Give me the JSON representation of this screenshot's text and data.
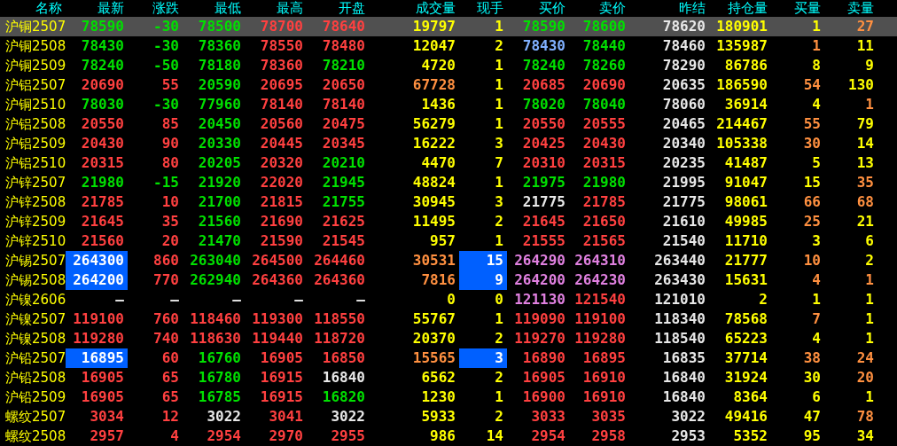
{
  "table": {
    "columns": [
      "名称",
      "最新",
      "涨跌",
      "最低",
      "最高",
      "开盘",
      "成交量",
      "现手",
      "买价",
      "卖价",
      "昨结",
      "持仓量",
      "买量",
      "卖量"
    ],
    "rows": [
      {
        "selected": true,
        "cells": [
          {
            "text": "沪铜2507",
            "color": "#ffff00",
            "flash": false
          },
          {
            "text": "78590",
            "color": "#00e000",
            "flash": false
          },
          {
            "text": "-30",
            "color": "#00e000",
            "flash": false
          },
          {
            "text": "78500",
            "color": "#00e000",
            "flash": false
          },
          {
            "text": "78700",
            "color": "#ff4040",
            "flash": false
          },
          {
            "text": "78640",
            "color": "#ff4040",
            "flash": false
          },
          {
            "text": "19797",
            "color": "#ffff00",
            "flash": false
          },
          {
            "text": "1",
            "color": "#ffff00",
            "flash": false
          },
          {
            "text": "78590",
            "color": "#00e000",
            "flash": false
          },
          {
            "text": "78600",
            "color": "#00e000",
            "flash": false
          },
          {
            "text": "78620",
            "color": "#e8e8e8",
            "flash": false
          },
          {
            "text": "180901",
            "color": "#ffff00",
            "flash": false
          },
          {
            "text": "1",
            "color": "#ffff00",
            "flash": false
          },
          {
            "text": "27",
            "color": "#ff9040",
            "flash": false
          }
        ]
      },
      {
        "selected": false,
        "cells": [
          {
            "text": "沪铜2508",
            "color": "#ffff00",
            "flash": false
          },
          {
            "text": "78430",
            "color": "#00e000",
            "flash": false
          },
          {
            "text": "-30",
            "color": "#00e000",
            "flash": false
          },
          {
            "text": "78360",
            "color": "#00e000",
            "flash": false
          },
          {
            "text": "78550",
            "color": "#ff4040",
            "flash": false
          },
          {
            "text": "78480",
            "color": "#ff4040",
            "flash": false
          },
          {
            "text": "12047",
            "color": "#ffff00",
            "flash": false
          },
          {
            "text": "2",
            "color": "#ffff00",
            "flash": false
          },
          {
            "text": "78430",
            "color": "#80b0ff",
            "flash": false
          },
          {
            "text": "78440",
            "color": "#00e000",
            "flash": false
          },
          {
            "text": "78460",
            "color": "#e8e8e8",
            "flash": false
          },
          {
            "text": "135987",
            "color": "#ffff00",
            "flash": false
          },
          {
            "text": "1",
            "color": "#ff9040",
            "flash": false
          },
          {
            "text": "11",
            "color": "#ffff00",
            "flash": false
          }
        ]
      },
      {
        "selected": false,
        "cells": [
          {
            "text": "沪铜2509",
            "color": "#ffff00",
            "flash": false
          },
          {
            "text": "78240",
            "color": "#00e000",
            "flash": false
          },
          {
            "text": "-50",
            "color": "#00e000",
            "flash": false
          },
          {
            "text": "78180",
            "color": "#00e000",
            "flash": false
          },
          {
            "text": "78360",
            "color": "#ff4040",
            "flash": false
          },
          {
            "text": "78210",
            "color": "#00e000",
            "flash": false
          },
          {
            "text": "4720",
            "color": "#ffff00",
            "flash": false
          },
          {
            "text": "1",
            "color": "#ffff00",
            "flash": false
          },
          {
            "text": "78240",
            "color": "#00e000",
            "flash": false
          },
          {
            "text": "78260",
            "color": "#00e000",
            "flash": false
          },
          {
            "text": "78290",
            "color": "#e8e8e8",
            "flash": false
          },
          {
            "text": "86786",
            "color": "#ffff00",
            "flash": false
          },
          {
            "text": "8",
            "color": "#ffff00",
            "flash": false
          },
          {
            "text": "9",
            "color": "#ffff00",
            "flash": false
          }
        ]
      },
      {
        "selected": false,
        "cells": [
          {
            "text": "沪铝2507",
            "color": "#ffff00",
            "flash": false
          },
          {
            "text": "20690",
            "color": "#ff4040",
            "flash": false
          },
          {
            "text": "55",
            "color": "#ff4040",
            "flash": false
          },
          {
            "text": "20590",
            "color": "#00e000",
            "flash": false
          },
          {
            "text": "20695",
            "color": "#ff4040",
            "flash": false
          },
          {
            "text": "20650",
            "color": "#ff4040",
            "flash": false
          },
          {
            "text": "67728",
            "color": "#ff9040",
            "flash": false
          },
          {
            "text": "1",
            "color": "#ffff00",
            "flash": false
          },
          {
            "text": "20685",
            "color": "#ff4040",
            "flash": false
          },
          {
            "text": "20690",
            "color": "#ff4040",
            "flash": false
          },
          {
            "text": "20635",
            "color": "#e8e8e8",
            "flash": false
          },
          {
            "text": "186590",
            "color": "#ffff00",
            "flash": false
          },
          {
            "text": "54",
            "color": "#ff9040",
            "flash": false
          },
          {
            "text": "130",
            "color": "#ffff00",
            "flash": false
          }
        ]
      },
      {
        "selected": false,
        "cells": [
          {
            "text": "沪铜2510",
            "color": "#ffff00",
            "flash": false
          },
          {
            "text": "78030",
            "color": "#00e000",
            "flash": false
          },
          {
            "text": "-30",
            "color": "#00e000",
            "flash": false
          },
          {
            "text": "77960",
            "color": "#00e000",
            "flash": false
          },
          {
            "text": "78140",
            "color": "#ff4040",
            "flash": false
          },
          {
            "text": "78140",
            "color": "#ff4040",
            "flash": false
          },
          {
            "text": "1436",
            "color": "#ffff00",
            "flash": false
          },
          {
            "text": "1",
            "color": "#ffff00",
            "flash": false
          },
          {
            "text": "78020",
            "color": "#00e000",
            "flash": false
          },
          {
            "text": "78040",
            "color": "#00e000",
            "flash": false
          },
          {
            "text": "78060",
            "color": "#e8e8e8",
            "flash": false
          },
          {
            "text": "36914",
            "color": "#ffff00",
            "flash": false
          },
          {
            "text": "4",
            "color": "#ffff00",
            "flash": false
          },
          {
            "text": "1",
            "color": "#ff9040",
            "flash": false
          }
        ]
      },
      {
        "selected": false,
        "cells": [
          {
            "text": "沪铝2508",
            "color": "#ffff00",
            "flash": false
          },
          {
            "text": "20550",
            "color": "#ff4040",
            "flash": false
          },
          {
            "text": "85",
            "color": "#ff4040",
            "flash": false
          },
          {
            "text": "20450",
            "color": "#00e000",
            "flash": false
          },
          {
            "text": "20560",
            "color": "#ff4040",
            "flash": false
          },
          {
            "text": "20475",
            "color": "#ff4040",
            "flash": false
          },
          {
            "text": "56279",
            "color": "#ffff00",
            "flash": false
          },
          {
            "text": "1",
            "color": "#ffff00",
            "flash": false
          },
          {
            "text": "20550",
            "color": "#ff4040",
            "flash": false
          },
          {
            "text": "20555",
            "color": "#ff4040",
            "flash": false
          },
          {
            "text": "20465",
            "color": "#e8e8e8",
            "flash": false
          },
          {
            "text": "214467",
            "color": "#ffff00",
            "flash": false
          },
          {
            "text": "55",
            "color": "#ff9040",
            "flash": false
          },
          {
            "text": "79",
            "color": "#ffff00",
            "flash": false
          }
        ]
      },
      {
        "selected": false,
        "cells": [
          {
            "text": "沪铝2509",
            "color": "#ffff00",
            "flash": false
          },
          {
            "text": "20430",
            "color": "#ff4040",
            "flash": false
          },
          {
            "text": "90",
            "color": "#ff4040",
            "flash": false
          },
          {
            "text": "20330",
            "color": "#00e000",
            "flash": false
          },
          {
            "text": "20445",
            "color": "#ff4040",
            "flash": false
          },
          {
            "text": "20345",
            "color": "#ff4040",
            "flash": false
          },
          {
            "text": "16222",
            "color": "#ffff00",
            "flash": false
          },
          {
            "text": "3",
            "color": "#ffff00",
            "flash": false
          },
          {
            "text": "20425",
            "color": "#ff4040",
            "flash": false
          },
          {
            "text": "20430",
            "color": "#ff4040",
            "flash": false
          },
          {
            "text": "20340",
            "color": "#e8e8e8",
            "flash": false
          },
          {
            "text": "105338",
            "color": "#ffff00",
            "flash": false
          },
          {
            "text": "30",
            "color": "#ff9040",
            "flash": false
          },
          {
            "text": "14",
            "color": "#ffff00",
            "flash": false
          }
        ]
      },
      {
        "selected": false,
        "cells": [
          {
            "text": "沪铝2510",
            "color": "#ffff00",
            "flash": false
          },
          {
            "text": "20315",
            "color": "#ff4040",
            "flash": false
          },
          {
            "text": "80",
            "color": "#ff4040",
            "flash": false
          },
          {
            "text": "20205",
            "color": "#00e000",
            "flash": false
          },
          {
            "text": "20320",
            "color": "#ff4040",
            "flash": false
          },
          {
            "text": "20210",
            "color": "#00e000",
            "flash": false
          },
          {
            "text": "4470",
            "color": "#ffff00",
            "flash": false
          },
          {
            "text": "7",
            "color": "#ffff00",
            "flash": false
          },
          {
            "text": "20310",
            "color": "#ff4040",
            "flash": false
          },
          {
            "text": "20315",
            "color": "#ff4040",
            "flash": false
          },
          {
            "text": "20235",
            "color": "#e8e8e8",
            "flash": false
          },
          {
            "text": "41487",
            "color": "#ffff00",
            "flash": false
          },
          {
            "text": "5",
            "color": "#ffff00",
            "flash": false
          },
          {
            "text": "13",
            "color": "#ffff00",
            "flash": false
          }
        ]
      },
      {
        "selected": false,
        "cells": [
          {
            "text": "沪锌2507",
            "color": "#ffff00",
            "flash": false
          },
          {
            "text": "21980",
            "color": "#00e000",
            "flash": false
          },
          {
            "text": "-15",
            "color": "#00e000",
            "flash": false
          },
          {
            "text": "21920",
            "color": "#00e000",
            "flash": false
          },
          {
            "text": "22020",
            "color": "#ff4040",
            "flash": false
          },
          {
            "text": "21945",
            "color": "#00e000",
            "flash": false
          },
          {
            "text": "48824",
            "color": "#ffff00",
            "flash": false
          },
          {
            "text": "1",
            "color": "#ffff00",
            "flash": false
          },
          {
            "text": "21975",
            "color": "#00e000",
            "flash": false
          },
          {
            "text": "21980",
            "color": "#00e000",
            "flash": false
          },
          {
            "text": "21995",
            "color": "#e8e8e8",
            "flash": false
          },
          {
            "text": "91047",
            "color": "#ffff00",
            "flash": false
          },
          {
            "text": "15",
            "color": "#ffff00",
            "flash": false
          },
          {
            "text": "35",
            "color": "#ff9040",
            "flash": false
          }
        ]
      },
      {
        "selected": false,
        "cells": [
          {
            "text": "沪锌2508",
            "color": "#ffff00",
            "flash": false
          },
          {
            "text": "21785",
            "color": "#ff4040",
            "flash": false
          },
          {
            "text": "10",
            "color": "#ff4040",
            "flash": false
          },
          {
            "text": "21700",
            "color": "#00e000",
            "flash": false
          },
          {
            "text": "21815",
            "color": "#ff4040",
            "flash": false
          },
          {
            "text": "21755",
            "color": "#00e000",
            "flash": false
          },
          {
            "text": "30945",
            "color": "#ffff00",
            "flash": false
          },
          {
            "text": "3",
            "color": "#ffff00",
            "flash": false
          },
          {
            "text": "21775",
            "color": "#e8e8e8",
            "flash": false
          },
          {
            "text": "21785",
            "color": "#ff4040",
            "flash": false
          },
          {
            "text": "21775",
            "color": "#e8e8e8",
            "flash": false
          },
          {
            "text": "98061",
            "color": "#ffff00",
            "flash": false
          },
          {
            "text": "66",
            "color": "#ff9040",
            "flash": false
          },
          {
            "text": "68",
            "color": "#ff9040",
            "flash": false
          }
        ]
      },
      {
        "selected": false,
        "cells": [
          {
            "text": "沪锌2509",
            "color": "#ffff00",
            "flash": false
          },
          {
            "text": "21645",
            "color": "#ff4040",
            "flash": false
          },
          {
            "text": "35",
            "color": "#ff4040",
            "flash": false
          },
          {
            "text": "21560",
            "color": "#00e000",
            "flash": false
          },
          {
            "text": "21690",
            "color": "#ff4040",
            "flash": false
          },
          {
            "text": "21625",
            "color": "#ff4040",
            "flash": false
          },
          {
            "text": "11495",
            "color": "#ffff00",
            "flash": false
          },
          {
            "text": "2",
            "color": "#ffff00",
            "flash": false
          },
          {
            "text": "21645",
            "color": "#ff4040",
            "flash": false
          },
          {
            "text": "21650",
            "color": "#ff4040",
            "flash": false
          },
          {
            "text": "21610",
            "color": "#e8e8e8",
            "flash": false
          },
          {
            "text": "49985",
            "color": "#ffff00",
            "flash": false
          },
          {
            "text": "25",
            "color": "#ff9040",
            "flash": false
          },
          {
            "text": "21",
            "color": "#ffff00",
            "flash": false
          }
        ]
      },
      {
        "selected": false,
        "cells": [
          {
            "text": "沪锌2510",
            "color": "#ffff00",
            "flash": false
          },
          {
            "text": "21560",
            "color": "#ff4040",
            "flash": false
          },
          {
            "text": "20",
            "color": "#ff4040",
            "flash": false
          },
          {
            "text": "21470",
            "color": "#00e000",
            "flash": false
          },
          {
            "text": "21590",
            "color": "#ff4040",
            "flash": false
          },
          {
            "text": "21545",
            "color": "#ff4040",
            "flash": false
          },
          {
            "text": "957",
            "color": "#ffff00",
            "flash": false
          },
          {
            "text": "1",
            "color": "#ffff00",
            "flash": false
          },
          {
            "text": "21555",
            "color": "#ff4040",
            "flash": false
          },
          {
            "text": "21565",
            "color": "#ff4040",
            "flash": false
          },
          {
            "text": "21540",
            "color": "#e8e8e8",
            "flash": false
          },
          {
            "text": "11710",
            "color": "#ffff00",
            "flash": false
          },
          {
            "text": "3",
            "color": "#ffff00",
            "flash": false
          },
          {
            "text": "6",
            "color": "#ffff00",
            "flash": false
          }
        ]
      },
      {
        "selected": false,
        "cells": [
          {
            "text": "沪锡2507",
            "color": "#ffff00",
            "flash": false
          },
          {
            "text": "264300",
            "color": "#ffffff",
            "flash": true
          },
          {
            "text": "860",
            "color": "#ff4040",
            "flash": false
          },
          {
            "text": "263040",
            "color": "#00e000",
            "flash": false
          },
          {
            "text": "264500",
            "color": "#ff4040",
            "flash": false
          },
          {
            "text": "264460",
            "color": "#ff4040",
            "flash": false
          },
          {
            "text": "30531",
            "color": "#ff9040",
            "flash": false
          },
          {
            "text": "15",
            "color": "#ffffff",
            "flash": true
          },
          {
            "text": "264290",
            "color": "#e080e0",
            "flash": false
          },
          {
            "text": "264310",
            "color": "#e080e0",
            "flash": false
          },
          {
            "text": "263440",
            "color": "#e8e8e8",
            "flash": false
          },
          {
            "text": "21777",
            "color": "#ffff00",
            "flash": false
          },
          {
            "text": "10",
            "color": "#ff9040",
            "flash": false
          },
          {
            "text": "2",
            "color": "#ffff00",
            "flash": false
          }
        ]
      },
      {
        "selected": false,
        "cells": [
          {
            "text": "沪锡2508",
            "color": "#ffff00",
            "flash": false
          },
          {
            "text": "264200",
            "color": "#ffffff",
            "flash": true
          },
          {
            "text": "770",
            "color": "#ff4040",
            "flash": false
          },
          {
            "text": "262940",
            "color": "#00e000",
            "flash": false
          },
          {
            "text": "264360",
            "color": "#ff4040",
            "flash": false
          },
          {
            "text": "264360",
            "color": "#ff4040",
            "flash": false
          },
          {
            "text": "7816",
            "color": "#ff9040",
            "flash": false
          },
          {
            "text": "9",
            "color": "#ffffff",
            "flash": true
          },
          {
            "text": "264200",
            "color": "#e080e0",
            "flash": false
          },
          {
            "text": "264230",
            "color": "#e080e0",
            "flash": false
          },
          {
            "text": "263430",
            "color": "#e8e8e8",
            "flash": false
          },
          {
            "text": "15631",
            "color": "#ffff00",
            "flash": false
          },
          {
            "text": "4",
            "color": "#ff9040",
            "flash": false
          },
          {
            "text": "1",
            "color": "#ff9040",
            "flash": false
          }
        ]
      },
      {
        "selected": false,
        "cells": [
          {
            "text": "沪镍2606",
            "color": "#ffff00",
            "flash": false
          },
          {
            "text": "—",
            "color": "#e8e8e8",
            "flash": false
          },
          {
            "text": "—",
            "color": "#e8e8e8",
            "flash": false
          },
          {
            "text": "—",
            "color": "#e8e8e8",
            "flash": false
          },
          {
            "text": "—",
            "color": "#e8e8e8",
            "flash": false
          },
          {
            "text": "—",
            "color": "#e8e8e8",
            "flash": false
          },
          {
            "text": "0",
            "color": "#ffff00",
            "flash": false
          },
          {
            "text": "0",
            "color": "#ffff00",
            "flash": false
          },
          {
            "text": "121130",
            "color": "#e080e0",
            "flash": false
          },
          {
            "text": "121540",
            "color": "#ff4040",
            "flash": false
          },
          {
            "text": "121010",
            "color": "#e8e8e8",
            "flash": false
          },
          {
            "text": "2",
            "color": "#ffff00",
            "flash": false
          },
          {
            "text": "1",
            "color": "#ffff00",
            "flash": false
          },
          {
            "text": "1",
            "color": "#ffff00",
            "flash": false
          }
        ]
      },
      {
        "selected": false,
        "cells": [
          {
            "text": "沪镍2507",
            "color": "#ffff00",
            "flash": false
          },
          {
            "text": "119100",
            "color": "#ff4040",
            "flash": false
          },
          {
            "text": "760",
            "color": "#ff4040",
            "flash": false
          },
          {
            "text": "118460",
            "color": "#ff4040",
            "flash": false
          },
          {
            "text": "119300",
            "color": "#ff4040",
            "flash": false
          },
          {
            "text": "118550",
            "color": "#ff4040",
            "flash": false
          },
          {
            "text": "55767",
            "color": "#ffff00",
            "flash": false
          },
          {
            "text": "1",
            "color": "#ffff00",
            "flash": false
          },
          {
            "text": "119090",
            "color": "#ff4040",
            "flash": false
          },
          {
            "text": "119100",
            "color": "#ff4040",
            "flash": false
          },
          {
            "text": "118340",
            "color": "#e8e8e8",
            "flash": false
          },
          {
            "text": "78568",
            "color": "#ffff00",
            "flash": false
          },
          {
            "text": "7",
            "color": "#ff9040",
            "flash": false
          },
          {
            "text": "1",
            "color": "#ffff00",
            "flash": false
          }
        ]
      },
      {
        "selected": false,
        "cells": [
          {
            "text": "沪镍2508",
            "color": "#ffff00",
            "flash": false
          },
          {
            "text": "119280",
            "color": "#ff4040",
            "flash": false
          },
          {
            "text": "740",
            "color": "#ff4040",
            "flash": false
          },
          {
            "text": "118630",
            "color": "#ff4040",
            "flash": false
          },
          {
            "text": "119440",
            "color": "#ff4040",
            "flash": false
          },
          {
            "text": "118720",
            "color": "#ff4040",
            "flash": false
          },
          {
            "text": "20370",
            "color": "#ffff00",
            "flash": false
          },
          {
            "text": "2",
            "color": "#ffff00",
            "flash": false
          },
          {
            "text": "119270",
            "color": "#ff4040",
            "flash": false
          },
          {
            "text": "119280",
            "color": "#ff4040",
            "flash": false
          },
          {
            "text": "118540",
            "color": "#e8e8e8",
            "flash": false
          },
          {
            "text": "65223",
            "color": "#ffff00",
            "flash": false
          },
          {
            "text": "4",
            "color": "#ffff00",
            "flash": false
          },
          {
            "text": "1",
            "color": "#ffff00",
            "flash": false
          }
        ]
      },
      {
        "selected": false,
        "cells": [
          {
            "text": "沪铅2507",
            "color": "#ffff00",
            "flash": false
          },
          {
            "text": "16895",
            "color": "#ffffff",
            "flash": true
          },
          {
            "text": "60",
            "color": "#ff4040",
            "flash": false
          },
          {
            "text": "16760",
            "color": "#00e000",
            "flash": false
          },
          {
            "text": "16905",
            "color": "#ff4040",
            "flash": false
          },
          {
            "text": "16850",
            "color": "#ff4040",
            "flash": false
          },
          {
            "text": "15565",
            "color": "#ff9040",
            "flash": false
          },
          {
            "text": "3",
            "color": "#ffffff",
            "flash": true
          },
          {
            "text": "16890",
            "color": "#ff4040",
            "flash": false
          },
          {
            "text": "16895",
            "color": "#ff4040",
            "flash": false
          },
          {
            "text": "16835",
            "color": "#e8e8e8",
            "flash": false
          },
          {
            "text": "37714",
            "color": "#ffff00",
            "flash": false
          },
          {
            "text": "38",
            "color": "#ff9040",
            "flash": false
          },
          {
            "text": "24",
            "color": "#ff9040",
            "flash": false
          }
        ]
      },
      {
        "selected": false,
        "cells": [
          {
            "text": "沪铅2508",
            "color": "#ffff00",
            "flash": false
          },
          {
            "text": "16905",
            "color": "#ff4040",
            "flash": false
          },
          {
            "text": "65",
            "color": "#ff4040",
            "flash": false
          },
          {
            "text": "16780",
            "color": "#00e000",
            "flash": false
          },
          {
            "text": "16915",
            "color": "#ff4040",
            "flash": false
          },
          {
            "text": "16840",
            "color": "#e8e8e8",
            "flash": false
          },
          {
            "text": "6562",
            "color": "#ffff00",
            "flash": false
          },
          {
            "text": "2",
            "color": "#ffff00",
            "flash": false
          },
          {
            "text": "16905",
            "color": "#ff4040",
            "flash": false
          },
          {
            "text": "16910",
            "color": "#ff4040",
            "flash": false
          },
          {
            "text": "16840",
            "color": "#e8e8e8",
            "flash": false
          },
          {
            "text": "31924",
            "color": "#ffff00",
            "flash": false
          },
          {
            "text": "30",
            "color": "#ffff00",
            "flash": false
          },
          {
            "text": "20",
            "color": "#ff9040",
            "flash": false
          }
        ]
      },
      {
        "selected": false,
        "cells": [
          {
            "text": "沪铅2509",
            "color": "#ffff00",
            "flash": false
          },
          {
            "text": "16905",
            "color": "#ff4040",
            "flash": false
          },
          {
            "text": "65",
            "color": "#ff4040",
            "flash": false
          },
          {
            "text": "16785",
            "color": "#00e000",
            "flash": false
          },
          {
            "text": "16915",
            "color": "#ff4040",
            "flash": false
          },
          {
            "text": "16820",
            "color": "#00e000",
            "flash": false
          },
          {
            "text": "1230",
            "color": "#ffff00",
            "flash": false
          },
          {
            "text": "1",
            "color": "#ffff00",
            "flash": false
          },
          {
            "text": "16900",
            "color": "#ff4040",
            "flash": false
          },
          {
            "text": "16910",
            "color": "#ff4040",
            "flash": false
          },
          {
            "text": "16840",
            "color": "#e8e8e8",
            "flash": false
          },
          {
            "text": "8364",
            "color": "#ffff00",
            "flash": false
          },
          {
            "text": "6",
            "color": "#ffff00",
            "flash": false
          },
          {
            "text": "1",
            "color": "#ffff00",
            "flash": false
          }
        ]
      },
      {
        "selected": false,
        "cells": [
          {
            "text": "螺纹2507",
            "color": "#ffff00",
            "flash": false
          },
          {
            "text": "3034",
            "color": "#ff4040",
            "flash": false
          },
          {
            "text": "12",
            "color": "#ff4040",
            "flash": false
          },
          {
            "text": "3022",
            "color": "#e8e8e8",
            "flash": false
          },
          {
            "text": "3041",
            "color": "#ff4040",
            "flash": false
          },
          {
            "text": "3022",
            "color": "#e8e8e8",
            "flash": false
          },
          {
            "text": "5933",
            "color": "#ffff00",
            "flash": false
          },
          {
            "text": "2",
            "color": "#ffff00",
            "flash": false
          },
          {
            "text": "3033",
            "color": "#ff4040",
            "flash": false
          },
          {
            "text": "3035",
            "color": "#ff4040",
            "flash": false
          },
          {
            "text": "3022",
            "color": "#e8e8e8",
            "flash": false
          },
          {
            "text": "49416",
            "color": "#ffff00",
            "flash": false
          },
          {
            "text": "47",
            "color": "#ffff00",
            "flash": false
          },
          {
            "text": "78",
            "color": "#ff9040",
            "flash": false
          }
        ]
      },
      {
        "selected": false,
        "cells": [
          {
            "text": "螺纹2508",
            "color": "#ffff00",
            "flash": false
          },
          {
            "text": "2957",
            "color": "#ff4040",
            "flash": false
          },
          {
            "text": "4",
            "color": "#ff4040",
            "flash": false
          },
          {
            "text": "2954",
            "color": "#ff4040",
            "flash": false
          },
          {
            "text": "2970",
            "color": "#ff4040",
            "flash": false
          },
          {
            "text": "2955",
            "color": "#ff4040",
            "flash": false
          },
          {
            "text": "986",
            "color": "#ffff00",
            "flash": false
          },
          {
            "text": "14",
            "color": "#ffff00",
            "flash": false
          },
          {
            "text": "2954",
            "color": "#ff4040",
            "flash": false
          },
          {
            "text": "2958",
            "color": "#ff4040",
            "flash": false
          },
          {
            "text": "2953",
            "color": "#e8e8e8",
            "flash": false
          },
          {
            "text": "5352",
            "color": "#ffff00",
            "flash": false
          },
          {
            "text": "95",
            "color": "#ffff00",
            "flash": false
          },
          {
            "text": "34",
            "color": "#ffff00",
            "flash": false
          }
        ]
      }
    ]
  }
}
